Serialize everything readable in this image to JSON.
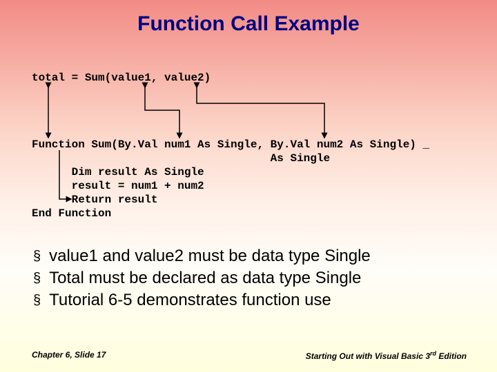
{
  "title": "Function Call Example",
  "code": {
    "line1": "total = Sum(value1, value2)",
    "funcDecl1": "Function Sum(By.Val num1 As Single, By.Val num2 As Single) _",
    "funcDecl2": "                                    As Single",
    "body1": "      Dim result As Single",
    "body2": "      result = num1 + num2",
    "body3": "      Return result",
    "endFn": "End Function"
  },
  "bullets": [
    "value1 and value2 must be data type Single",
    "Total must be declared as data type Single",
    "Tutorial 6-5 demonstrates function use"
  ],
  "footer": {
    "left": "Chapter 6, Slide 17",
    "rightPrefix": "Starting Out with Visual Basic 3",
    "rightSup": "rd",
    "rightSuffix": " Edition"
  },
  "colors": {
    "titleColor": "#000080",
    "arrowColor": "#000000"
  }
}
